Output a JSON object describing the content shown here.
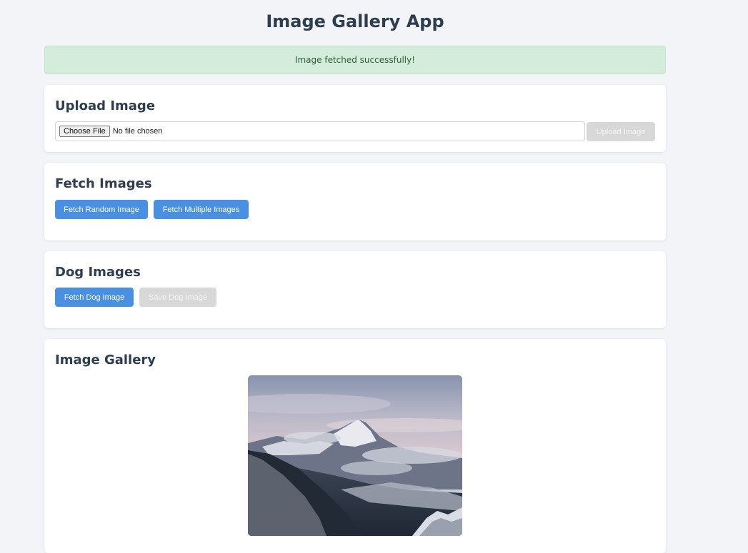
{
  "header": {
    "title": "Image Gallery App"
  },
  "alert": {
    "message": "Image fetched successfully!",
    "color": "#d4edda"
  },
  "upload": {
    "title": "Upload Image",
    "file_button": "Choose File",
    "file_status": "No file chosen",
    "upload_button": "Upload Image"
  },
  "fetch": {
    "title": "Fetch Images",
    "random_button": "Fetch Random Image",
    "multiple_button": "Fetch Multiple Images"
  },
  "dog": {
    "title": "Dog Images",
    "fetch_button": "Fetch Dog Image",
    "save_button": "Save Dog Image"
  },
  "gallery": {
    "title": "Image Gallery",
    "images": [
      {
        "subject": "snowy-mountain-landscape"
      }
    ]
  },
  "colors": {
    "accent": "#4a90e2",
    "disabled": "#d8d8d8",
    "heading": "#2c3e50"
  }
}
